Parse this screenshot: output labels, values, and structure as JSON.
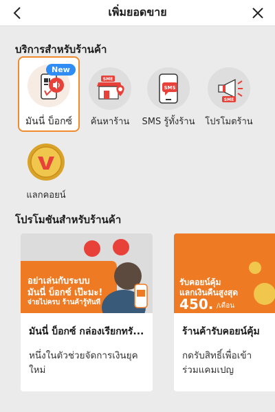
{
  "header": {
    "title": "เพิ่มยอดขาย"
  },
  "services_section": {
    "title": "บริการสำหรับร้านค้า",
    "badge": "New",
    "items": [
      {
        "label": "มันนี่ บ็อกซ์",
        "icon": "money-box-icon",
        "selected": true
      },
      {
        "label": "ค้นหาร้าน",
        "icon": "store-locator-icon"
      },
      {
        "label": "SMS รู้ทั้งร้าน",
        "icon": "sms-phone-icon"
      },
      {
        "label": "โปรโมตร้าน",
        "icon": "megaphone-icon"
      },
      {
        "label": "แลกคอยน์",
        "icon": "coin-icon"
      }
    ],
    "sme_tag": "SME",
    "sms_tag": "SMS"
  },
  "promo_section": {
    "title": "โปรโมชันสำหรับร้านค้า",
    "cards": [
      {
        "banner_line1": "อย่าเล่นกับระบบ",
        "banner_line2": "มันนี่ บ็อกซ์ เป๊ะมะ!",
        "banner_line3": "จ่ายไปครบ ร้านค้ารู้ทันที",
        "title": "มันนี่ บ็อกซ์ กล่องเรียกทรั...",
        "description": "หนึ่งในตัวช่วยจัดการเงินยุคใหม่"
      },
      {
        "banner_line1": "รับคอยน์คุ้ม",
        "banner_line2": "แลกเงินคืนสูงสุด",
        "banner_amount": "450.",
        "banner_unit": "/เดือน",
        "title": "ร้านค้ารับคอยน์คุ้ม",
        "description": "กดรับสิทธิ์เพื่อเข้าร่วมแคมเปญ"
      }
    ]
  },
  "colors": {
    "accent": "#f18a2c",
    "brand_red": "#e8413a",
    "badge_blue": "#2f8df5",
    "coin_gold": "#d9a32a"
  }
}
